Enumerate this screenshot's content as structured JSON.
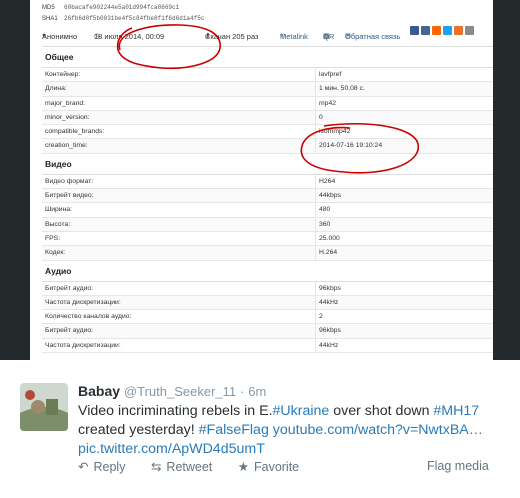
{
  "hashes": {
    "md5_label": "MD5",
    "md5": "60bacafe902244e5a01d994fca8669c1",
    "sha1_label": "SHA1",
    "sha1": "26fb6d0f5b0031be4f5c84fbe8f1f6d6d1a4f5c"
  },
  "meta_bar": {
    "author": "Анонимно",
    "date": "18 июля 2014, 00:09",
    "downloads": "Скачан 205 раз",
    "metalink": "Metalink",
    "qr": "QR",
    "feedback": "Обратная связь",
    "share_colors": [
      "#3b5998",
      "#45668e",
      "#ff6600",
      "#1da1f2",
      "#eb722e",
      "#8a8a8a"
    ]
  },
  "sections": [
    {
      "title": "Общее",
      "rows": [
        {
          "label": "Контейнер:",
          "value": "lavfpref"
        },
        {
          "label": "Длина:",
          "value": "1 мин. 50.08 с."
        },
        {
          "label": "major_brand:",
          "value": "mp42"
        },
        {
          "label": "minor_version:",
          "value": "0"
        },
        {
          "label": "compatible_brands:",
          "value": "isommp42"
        },
        {
          "label": "creation_time:",
          "value": "2014-07-16 19:10:24"
        }
      ]
    },
    {
      "title": "Видео",
      "rows": [
        {
          "label": "Видео формат:",
          "value": "H264"
        },
        {
          "label": "Битрейт видео:",
          "value": "44kbps"
        },
        {
          "label": "Ширина:",
          "value": "480"
        },
        {
          "label": "Высота:",
          "value": "360"
        },
        {
          "label": "FPS:",
          "value": "25.000"
        },
        {
          "label": "Кодек:",
          "value": "H.264"
        }
      ]
    },
    {
      "title": "Аудио",
      "rows": [
        {
          "label": "Битрейт аудио:",
          "value": "96kbps"
        },
        {
          "label": "Частота дискретизации:",
          "value": "44kHz"
        },
        {
          "label": "Количество каналов аудио:",
          "value": "2"
        },
        {
          "label": "Битрейт аудио:",
          "value": "96kbps"
        },
        {
          "label": "Частота дискретизации:",
          "value": "44kHz"
        }
      ]
    }
  ],
  "tweet": {
    "name": "Babay",
    "handle": "@Truth_Seeker_11",
    "separator": "·",
    "time": "6m",
    "text_parts": [
      {
        "t": "Video incriminating rebels in E.",
        "k": "text"
      },
      {
        "t": "#Ukraine",
        "k": "tag"
      },
      {
        "t": " over shot down ",
        "k": "text"
      },
      {
        "t": "#MH17",
        "k": "tag"
      },
      {
        "t": " created yesterday! ",
        "k": "text"
      },
      {
        "t": "#FalseFlag",
        "k": "tag"
      },
      {
        "t": " ",
        "k": "text"
      },
      {
        "t": "youtube.com/watch?v=NwtxBA…",
        "k": "lnk"
      },
      {
        "t": " ",
        "k": "text"
      },
      {
        "t": "pic.twitter.com/ApWD4d5umT",
        "k": "lnk"
      }
    ],
    "actions": {
      "reply": "Reply",
      "retweet": "Retweet",
      "favorite": "Favorite"
    },
    "flag_media": "Flag media",
    "colors": {
      "link": "#2b7bb9",
      "muted": "#8899a6",
      "text": "#292f33"
    }
  }
}
